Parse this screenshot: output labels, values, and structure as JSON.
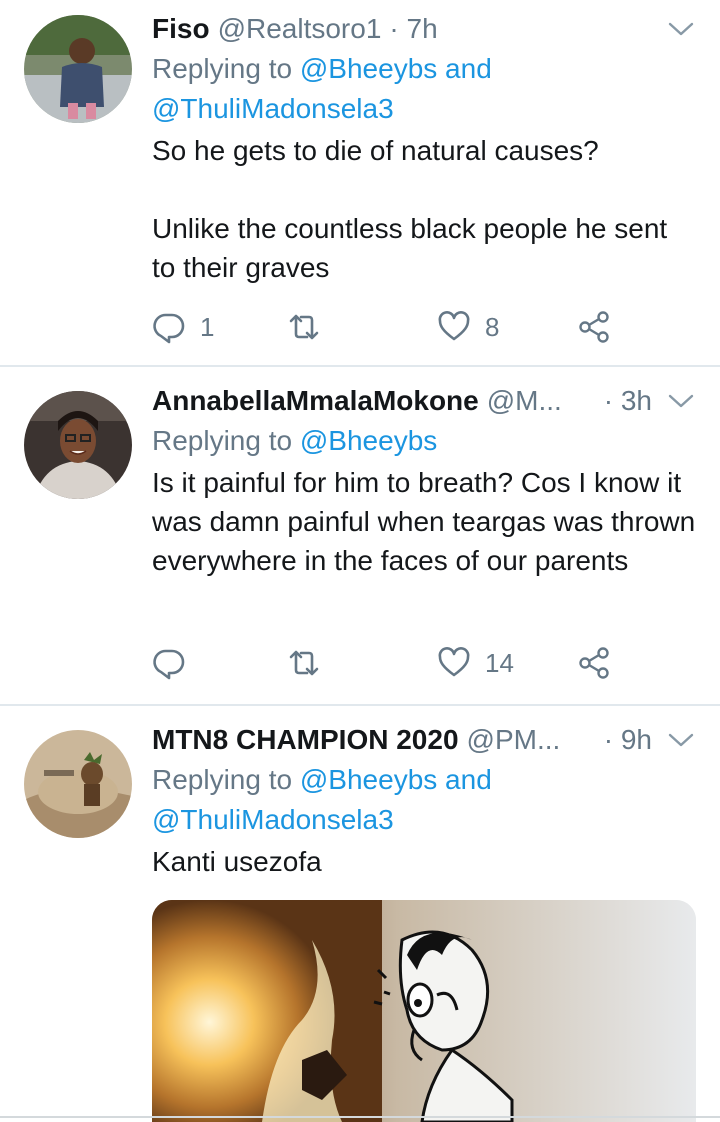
{
  "tweets": [
    {
      "name": "Fiso",
      "handle": "@Realtsoro1",
      "time": "· 7h",
      "reply_prefix": "Replying to ",
      "reply_line1_link": "@Bheeybs and",
      "reply_line2_link": "@ThuliMadonsela3",
      "text": "So he gets to die of natural causes?\n\nUnlike the countless black people he sent to their graves",
      "reply_count": "1",
      "retweet_count": "",
      "like_count": "8"
    },
    {
      "name": "AnnabellaMmalaMokone",
      "handle": "@M...",
      "time": "· 3h",
      "reply_prefix": "Replying to ",
      "reply_line1_link": "@Bheeybs",
      "text": "Is it painful for him to breath? Cos I know it was damn painful when teargas was thrown everywhere in the faces of our parents",
      "reply_count": "",
      "retweet_count": "",
      "like_count": "14"
    },
    {
      "name": "MTN8 CHAMPION 2020",
      "handle": "@PM...",
      "time": "· 9h",
      "reply_prefix": "Replying to ",
      "reply_line1_link": "@Bheeybs and",
      "reply_line2_link": "@ThuliMadonsela3",
      "text": "Kanti usezofa"
    }
  ],
  "icons": {
    "reply": "reply-icon",
    "retweet": "retweet-icon",
    "like": "heart-icon",
    "share": "share-icon",
    "menu": "chevron-down-icon"
  },
  "colors": {
    "link": "#1b95e0",
    "muted": "#657786",
    "text": "#14171a",
    "divider": "#e1e8ed"
  }
}
